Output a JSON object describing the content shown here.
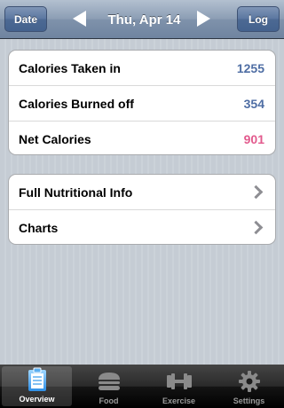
{
  "navbar": {
    "left_button": "Date",
    "title": "Thu, Apr 14",
    "right_button": "Log"
  },
  "summary": [
    {
      "label": "Calories Taken in",
      "value": "1255",
      "color": "#4f6ea4"
    },
    {
      "label": "Calories Burned off",
      "value": "354",
      "color": "#4f6ea4"
    },
    {
      "label": "Net Calories",
      "value": "901",
      "color": "#e25a8d"
    }
  ],
  "links": [
    {
      "label": "Full Nutritional Info"
    },
    {
      "label": "Charts"
    }
  ],
  "tabbar": {
    "tabs": [
      {
        "label": "Overview",
        "icon": "clipboard-icon",
        "active": true
      },
      {
        "label": "Food",
        "icon": "burger-icon",
        "active": false
      },
      {
        "label": "Exercise",
        "icon": "dumbbell-icon",
        "active": false
      },
      {
        "label": "Settings",
        "icon": "gear-icon",
        "active": false
      }
    ]
  }
}
